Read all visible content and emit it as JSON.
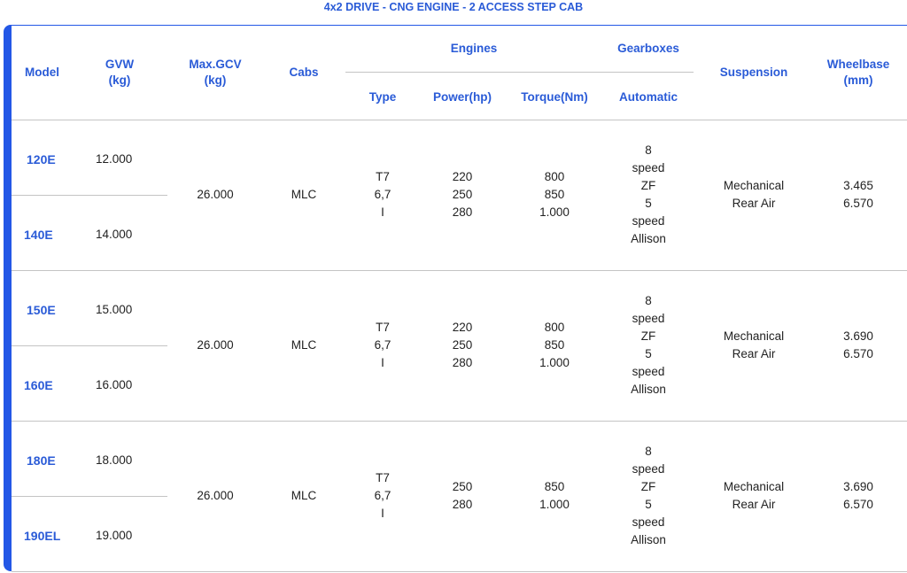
{
  "title": "4x2 DRIVE - CNG ENGINE - 2 ACCESS STEP CAB",
  "headers": {
    "model": "Model",
    "gvw": "GVW\n(kg)",
    "gcv": "Max.GCV\n(kg)",
    "cabs": "Cabs",
    "engines": "Engines",
    "gearboxes": "Gearboxes",
    "type": "Type",
    "power": "Power(hp)",
    "torque": "Torque(Nm)",
    "automatic": "Automatic",
    "suspension": "Suspension",
    "wheelbase": "Wheelbase\n(mm)"
  },
  "groups": [
    {
      "models": [
        {
          "name": "120E",
          "gvw": "12.000"
        },
        {
          "name": "140E",
          "gvw": "14.000"
        }
      ],
      "gcv": "26.000",
      "cabs": "MLC",
      "type": "T7\n6,7\nI",
      "power": "220\n250\n280",
      "torque": "800\n850\n1.000",
      "automatic": "8\nspeed\nZF\n5\nspeed\nAllison",
      "suspension": "Mechanical\nRear Air",
      "wheelbase": "3.465\n6.570"
    },
    {
      "models": [
        {
          "name": "150E",
          "gvw": "15.000"
        },
        {
          "name": "160E",
          "gvw": "16.000"
        }
      ],
      "gcv": "26.000",
      "cabs": "MLC",
      "type": "T7\n6,7\nI",
      "power": "220\n250\n280",
      "torque": "800\n850\n1.000",
      "automatic": "8\nspeed\nZF\n5\nspeed\nAllison",
      "suspension": "Mechanical\nRear Air",
      "wheelbase": "3.690\n6.570"
    },
    {
      "models": [
        {
          "name": "180E",
          "gvw": "18.000"
        },
        {
          "name": "190EL",
          "gvw": "19.000"
        }
      ],
      "gcv": "26.000",
      "cabs": "MLC",
      "type": "T7\n6,7\nI",
      "power": "250\n280",
      "torque": "850\n1.000",
      "automatic": "8\nspeed\nZF\n5\nspeed\nAllison",
      "suspension": "Mechanical\nRear Air",
      "wheelbase": "3.690\n6.570"
    }
  ]
}
